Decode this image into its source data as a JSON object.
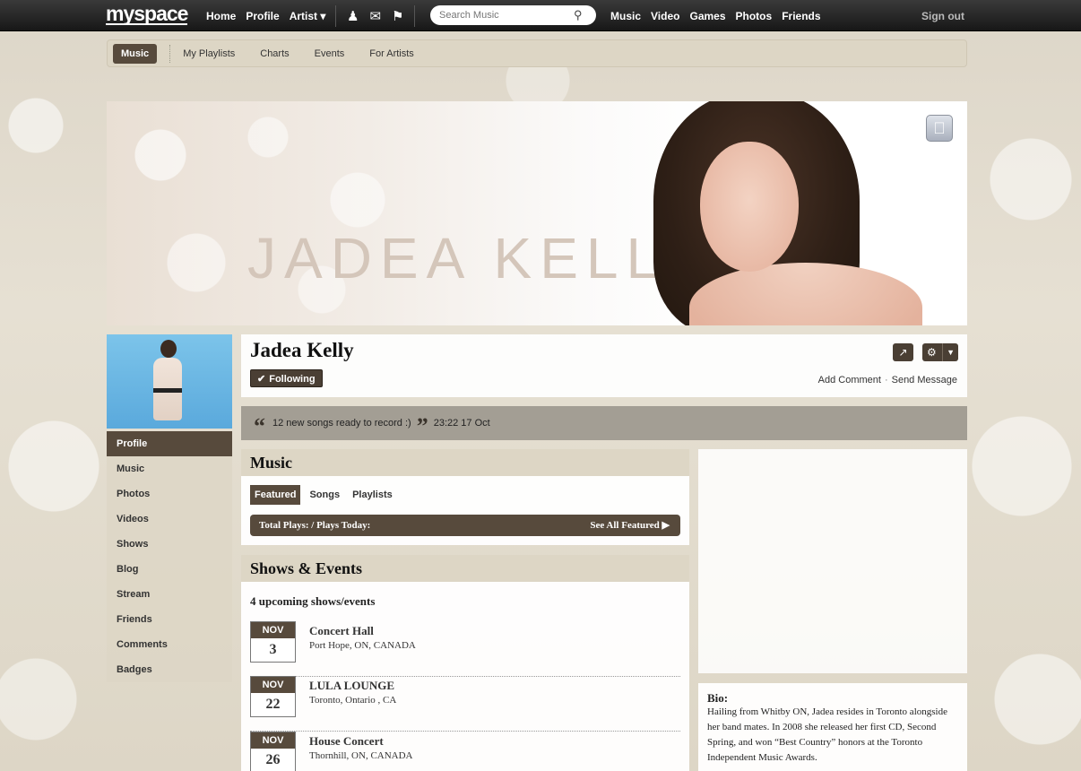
{
  "topbar": {
    "logo": "myspace",
    "nav_left": [
      "Home",
      "Profile",
      "Artist ▾"
    ],
    "icons": [
      "person-icon",
      "mail-icon",
      "flag-icon"
    ],
    "search_placeholder": "Search Music",
    "nav_right": [
      "Music",
      "Video",
      "Games",
      "Photos",
      "Friends"
    ],
    "signout": "Sign out"
  },
  "subnav": {
    "active": "Music",
    "items": [
      "My Playlists",
      "Charts",
      "Events",
      "For Artists"
    ]
  },
  "banner": {
    "name_text": "JADEA KELLY"
  },
  "sidebar": {
    "items": [
      "Profile",
      "Music",
      "Photos",
      "Videos",
      "Shows",
      "Blog",
      "Stream",
      "Friends",
      "Comments",
      "Badges"
    ],
    "active_index": 0
  },
  "profile": {
    "name": "Jadea Kelly",
    "following_label": "Following",
    "add_comment": "Add Comment",
    "send_message": "Send Message",
    "separator": "·"
  },
  "status": {
    "text": "12 new songs ready to record :)",
    "time": "23:22 17 Oct",
    "open_quote": "“",
    "close_quote": "”"
  },
  "music": {
    "title": "Music",
    "tabs": [
      "Featured",
      "Songs",
      "Playlists"
    ],
    "plays_label": "Total Plays: / Plays Today:",
    "see_all": "See All Featured ▶"
  },
  "shows": {
    "title": "Shows & Events",
    "count_text": "4 upcoming shows/events",
    "events": [
      {
        "month": "NOV",
        "day": "3",
        "venue": "Concert Hall",
        "location": "Port Hope, ON, CANADA"
      },
      {
        "month": "NOV",
        "day": "22",
        "venue": "LULA LOUNGE",
        "location": "Toronto, Ontario , CA"
      },
      {
        "month": "NOV",
        "day": "26",
        "venue": "House Concert",
        "location": "Thornhill, ON, CANADA"
      }
    ]
  },
  "bio": {
    "label": "Bio:",
    "text": "Hailing from Whitby ON, Jadea resides in Toronto alongside her band mates. In 2008 she released her first CD, Second Spring, and won “Best Country” honors at the Toronto Independent Music Awards."
  },
  "colors": {
    "accent_brown": "#574a3c",
    "panel_beige": "#ddd6c5",
    "status_gray": "#a39e94"
  }
}
